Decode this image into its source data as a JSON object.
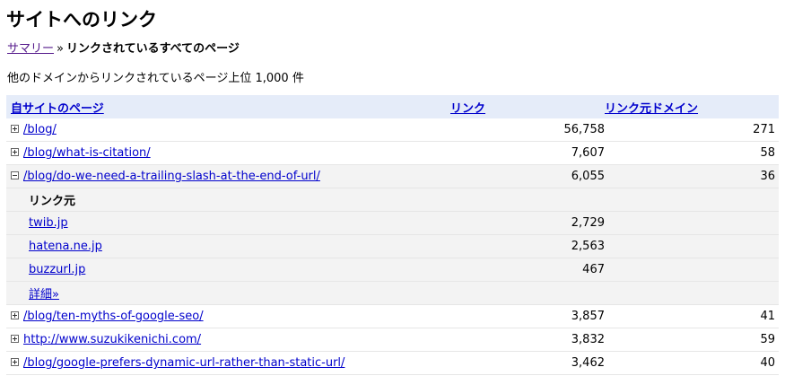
{
  "page": {
    "title": "サイトへのリンク",
    "breadcrumb": {
      "summary_link": "サマリー",
      "separator": "»",
      "current": "リンクされているすべてのページ"
    },
    "summary_text": "他のドメインからリンクされているページ上位 1,000 件"
  },
  "table": {
    "headers": {
      "page": "自サイトのページ",
      "links": "リンク",
      "domains": "リンク元ドメイン"
    },
    "rows": [
      {
        "page": "/blog/",
        "links": "56,758",
        "domains": "271",
        "expanded": false
      },
      {
        "page": "/blog/what-is-citation/",
        "links": "7,607",
        "domains": "58",
        "expanded": false
      },
      {
        "page": "/blog/do-we-need-a-trailing-slash-at-the-end-of-url/",
        "links": "6,055",
        "domains": "36",
        "expanded": true
      }
    ],
    "sources": {
      "heading": "リンク元",
      "items": [
        {
          "domain": "twib.jp",
          "links": "2,729"
        },
        {
          "domain": "hatena.ne.jp",
          "links": "2,563"
        },
        {
          "domain": "buzzurl.jp",
          "links": "467"
        }
      ],
      "more_link": "詳細»"
    },
    "rows_after": [
      {
        "page": "/blog/ten-myths-of-google-seo/",
        "links": "3,857",
        "domains": "41",
        "expanded": false
      },
      {
        "page": "http://www.suzukikenichi.com/",
        "links": "3,832",
        "domains": "59",
        "expanded": false
      },
      {
        "page": "/blog/google-prefers-dynamic-url-rather-than-static-url/",
        "links": "3,462",
        "domains": "40",
        "expanded": false
      }
    ]
  }
}
